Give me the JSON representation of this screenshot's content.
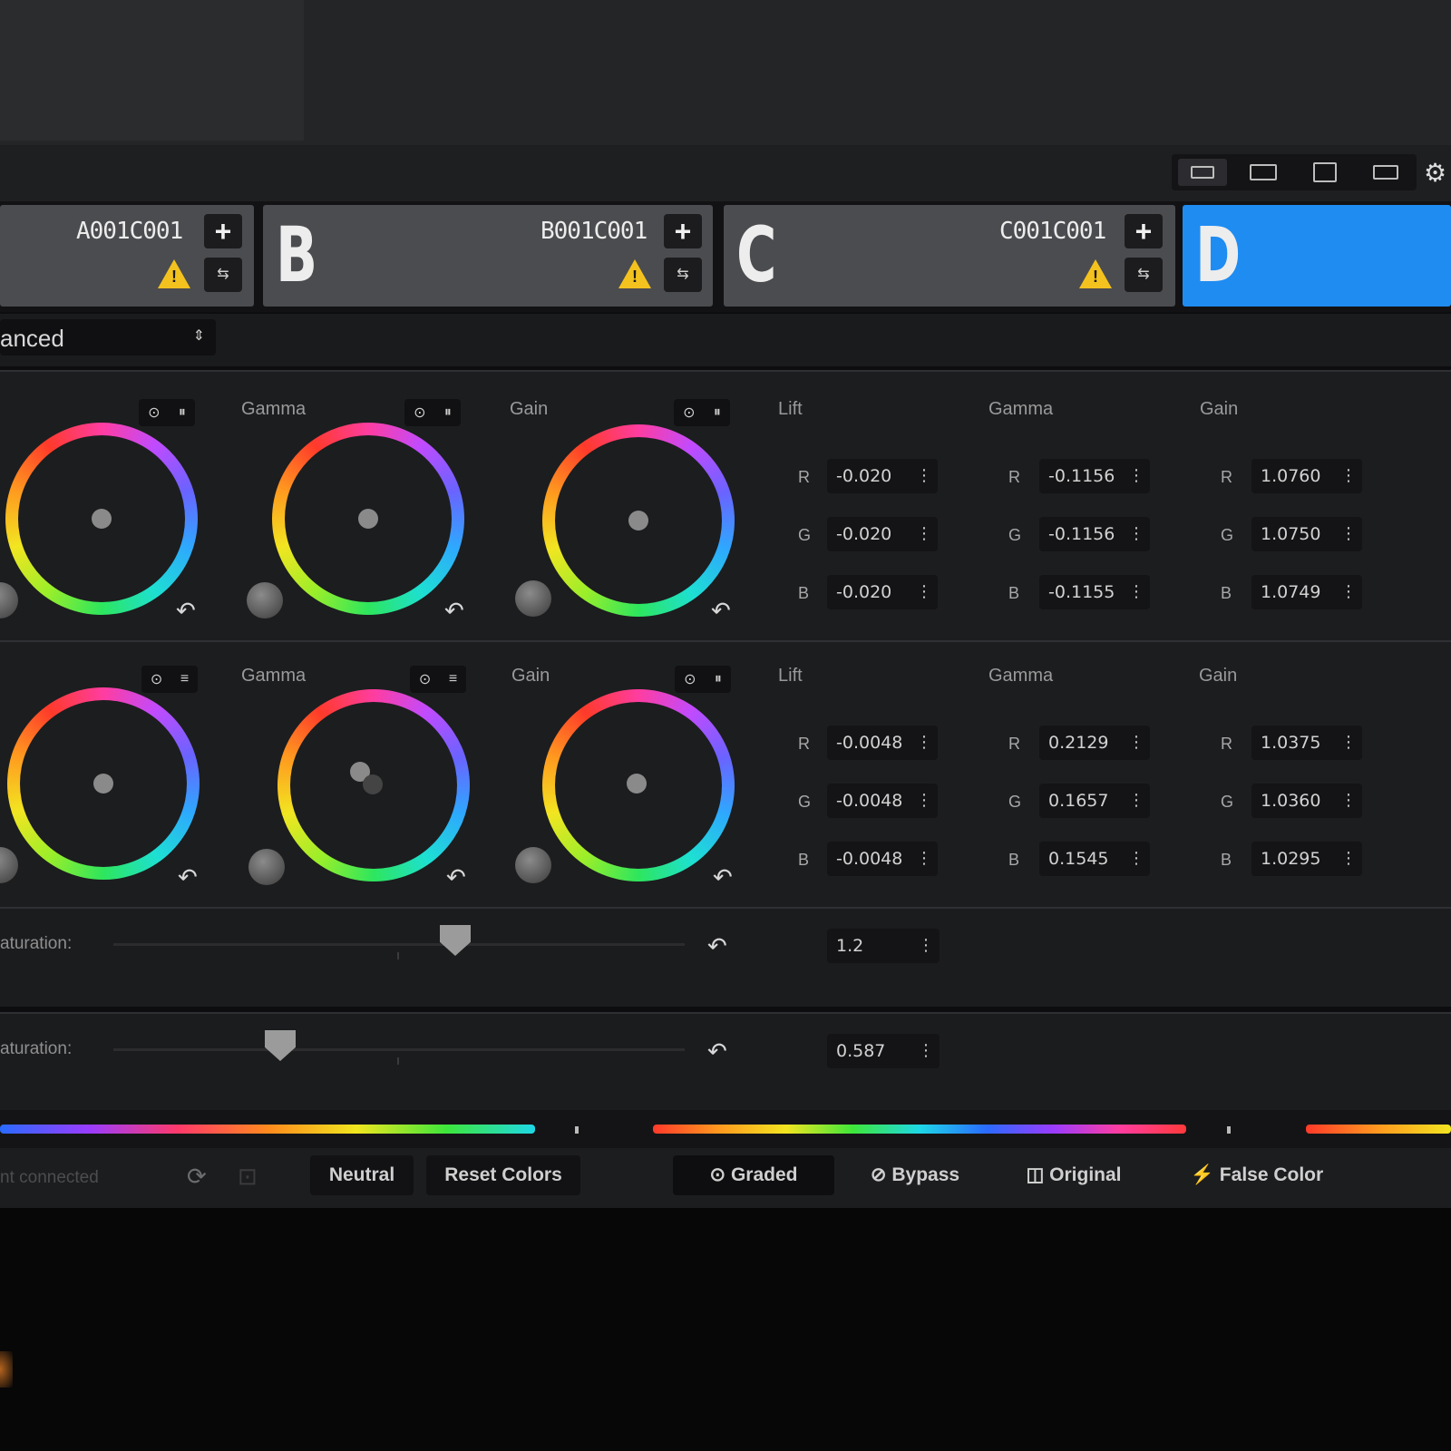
{
  "cameras": [
    {
      "letter": "",
      "clip": "A001C001"
    },
    {
      "letter": "B",
      "clip": "B001C001"
    },
    {
      "letter": "C",
      "clip": "C001C001"
    },
    {
      "letter": "D",
      "clip": ""
    }
  ],
  "camera_buttons": {
    "plus": "+",
    "swap": "⇆",
    "warning": "!"
  },
  "mode": {
    "label": "anced",
    "arrows": "⇕"
  },
  "wheel_panels": [
    {
      "wheels": [
        {
          "label": "",
          "controls": [
            "⊙",
            "⏸"
          ]
        },
        {
          "label": "Gamma",
          "controls": [
            "⊙",
            "⏸"
          ]
        },
        {
          "label": "Gain",
          "controls": [
            "⊙",
            "⏸"
          ]
        }
      ],
      "numeric": [
        {
          "label": "Lift",
          "values": [
            {
              "ch": "R",
              "val": "-0.020"
            },
            {
              "ch": "G",
              "val": "-0.020"
            },
            {
              "ch": "B",
              "val": "-0.020"
            }
          ]
        },
        {
          "label": "Gamma",
          "values": [
            {
              "ch": "R",
              "val": "-0.1156"
            },
            {
              "ch": "G",
              "val": "-0.1156"
            },
            {
              "ch": "B",
              "val": "-0.1155"
            }
          ]
        },
        {
          "label": "Gain",
          "values": [
            {
              "ch": "R",
              "val": "1.0760"
            },
            {
              "ch": "G",
              "val": "1.0750"
            },
            {
              "ch": "B",
              "val": "1.0749"
            }
          ]
        }
      ]
    },
    {
      "wheels": [
        {
          "label": "",
          "controls": [
            "⊙",
            "≡"
          ]
        },
        {
          "label": "Gamma",
          "controls": [
            "⊙",
            "≡"
          ]
        },
        {
          "label": "Gain",
          "controls": [
            "⊙",
            "⏸"
          ]
        }
      ],
      "numeric": [
        {
          "label": "Lift",
          "values": [
            {
              "ch": "R",
              "val": "-0.0048"
            },
            {
              "ch": "G",
              "val": "-0.0048"
            },
            {
              "ch": "B",
              "val": "-0.0048"
            }
          ]
        },
        {
          "label": "Gamma",
          "values": [
            {
              "ch": "R",
              "val": "0.2129"
            },
            {
              "ch": "G",
              "val": "0.1657"
            },
            {
              "ch": "B",
              "val": "0.1545"
            }
          ]
        },
        {
          "label": "Gain",
          "values": [
            {
              "ch": "R",
              "val": "1.0375"
            },
            {
              "ch": "G",
              "val": "1.0360"
            },
            {
              "ch": "B",
              "val": "1.0295"
            }
          ]
        }
      ]
    }
  ],
  "saturation_rows": [
    {
      "label": "aturation:",
      "value": "1.2",
      "slider_level": 0.58
    },
    {
      "label": "aturation:",
      "value": "0.587",
      "slider_level": 0.28
    }
  ],
  "bottom": {
    "status": "nt connected",
    "neutral": "Neutral",
    "reset_colors": "Reset Colors",
    "graded": "⊙ Graded",
    "bypass": "⊘ Bypass",
    "original": "◫ Original",
    "false_color": "⚡ False Color"
  },
  "icons": {
    "gear": "⚙",
    "reset": "↶",
    "spinner": "⋮",
    "loop": "⟳",
    "camera": "⊡"
  },
  "colors": {
    "active_camera": "#1f8cf2",
    "warning": "#f4c21f"
  }
}
